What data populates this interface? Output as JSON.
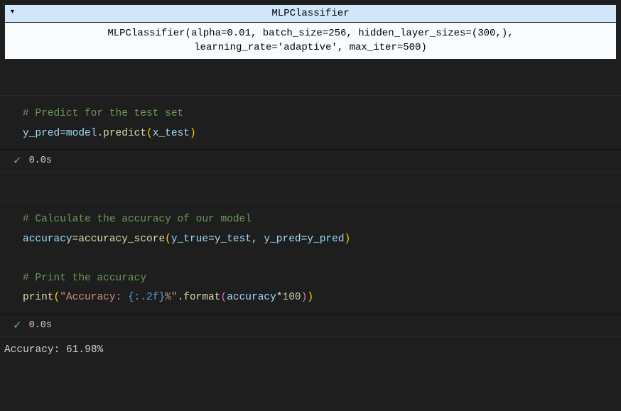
{
  "model_output": {
    "header": "MLPClassifier",
    "body_line1": "MLPClassifier(alpha=0.01, batch_size=256, hidden_layer_sizes=(300,),",
    "body_line2": "learning_rate='adaptive', max_iter=500)"
  },
  "cells": [
    {
      "code": {
        "comment1": "# Predict for the test set",
        "l2_a": "y_pred",
        "l2_eq": "=",
        "l2_b": "model",
        "l2_dot": ".",
        "l2_c": "predict",
        "l2_lp": "(",
        "l2_d": "x_test",
        "l2_rp": ")"
      },
      "status": {
        "time": "0.0s"
      }
    },
    {
      "code": {
        "comment1": "# Calculate the accuracy of our model",
        "l2_a": "accuracy",
        "l2_eq": "=",
        "l2_b": "accuracy_score",
        "l2_lp": "(",
        "l2_c": "y_true",
        "l2_eq2": "=",
        "l2_d": "y_test",
        "l2_com": ", ",
        "l2_e": "y_pred",
        "l2_eq3": "=",
        "l2_f": "y_pred",
        "l2_rp": ")",
        "comment2": "# Print the accuracy",
        "l4_a": "print",
        "l4_lp": "(",
        "l4_s1": "\"Accuracy: ",
        "l4_fmt": "{:.2f}",
        "l4_s2": "%\"",
        "l4_dot": ".",
        "l4_b": "format",
        "l4_lp2": "(",
        "l4_c": "accuracy",
        "l4_mul": "*",
        "l4_num": "100",
        "l4_rp2": ")",
        "l4_rp": ")"
      },
      "status": {
        "time": "0.0s"
      },
      "output": "Accuracy: 61.98%"
    }
  ]
}
